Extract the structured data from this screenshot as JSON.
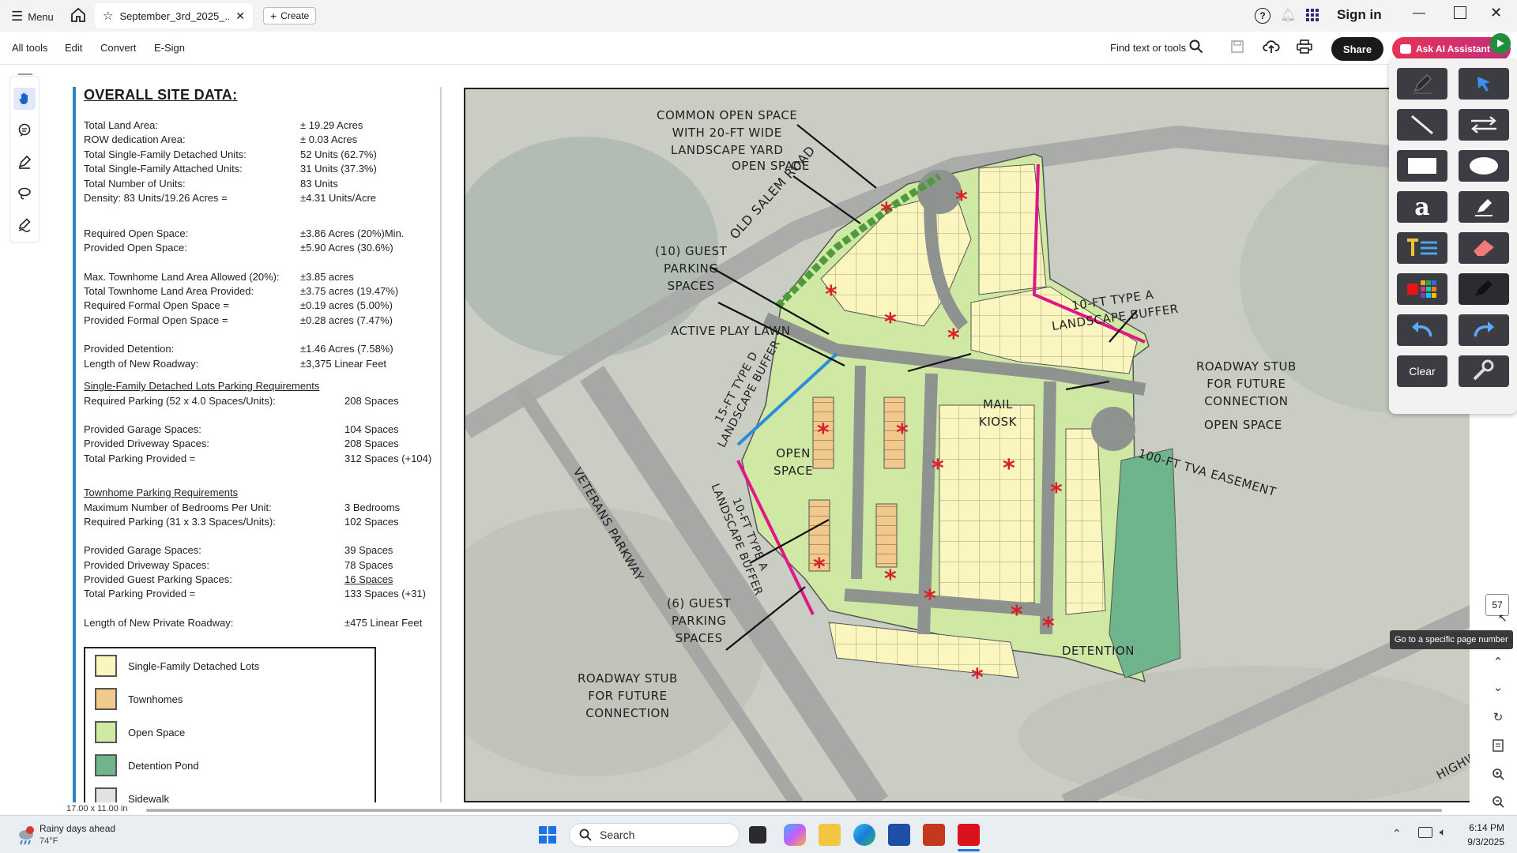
{
  "titlebar": {
    "menu_label": "Menu",
    "tab_title": "September_3rd_2025_...",
    "create_label": "Create",
    "sign_in": "Sign in"
  },
  "toolbar": {
    "items": [
      "All tools",
      "Edit",
      "Convert",
      "E-Sign"
    ],
    "find_label": "Find text or tools",
    "share_label": "Share",
    "ai_label": "Ask AI Assistant"
  },
  "site_data": {
    "title": "OVERALL SITE DATA:",
    "rows": [
      {
        "label": "Total Land Area:",
        "value": "± 19.29 Acres"
      },
      {
        "label": "ROW dedication Area:",
        "value": "± 0.03 Acres"
      },
      {
        "label": "Total Single-Family Detached Units:",
        "value": "52 Units (62.7%)"
      },
      {
        "label": "Total Single-Family Attached Units:",
        "value": "31 Units (37.3%)"
      },
      {
        "label": "Total Number of Units:",
        "value": "83 Units"
      },
      {
        "label": "Density: 83 Units/19.26 Acres =",
        "value": "±4.31 Units/Acre"
      },
      {
        "label": "Required Open Space:",
        "value": "±3.86 Acres (20%)Min."
      },
      {
        "label": "Provided Open Space:",
        "value": "±5.90 Acres (30.6%)"
      },
      {
        "label": "Max. Townhome Land Area Allowed (20%):",
        "value": "±3.85 acres"
      },
      {
        "label": "Total Townhome Land Area Provided:",
        "value": "±3.75 acres (19.47%)"
      },
      {
        "label": "Required Formal Open Space =",
        "value": "±0.19 acres (5.00%)"
      },
      {
        "label": "Provided Formal Open Space =",
        "value": "±0.28 acres (7.47%)"
      },
      {
        "label": "Provided Detention:",
        "value": "±1.46 Acres (7.58%)"
      },
      {
        "label": "Length of New Roadway:",
        "value": "±3,375 Linear Feet"
      }
    ],
    "sf_heading": "Single-Family Detached Lots Parking Requirements",
    "sf_rows": [
      {
        "label": "Required Parking (52 x 4.0 Spaces/Units):",
        "value": "208 Spaces"
      },
      {
        "label": "Provided Garage Spaces:",
        "value": "104 Spaces"
      },
      {
        "label": "Provided Driveway Spaces:",
        "value": "208 Spaces"
      },
      {
        "label": "Total Parking Provided =",
        "value": "312 Spaces (+104)"
      }
    ],
    "th_heading": "Townhome Parking Requirements",
    "th_rows": [
      {
        "label": "Maximum Number of Bedrooms Per Unit:",
        "value": "3 Bedrooms"
      },
      {
        "label": "Required Parking (31 x 3.3 Spaces/Units):",
        "value": "102 Spaces"
      },
      {
        "label": "Provided Garage Spaces:",
        "value": "39 Spaces"
      },
      {
        "label": "Provided Driveway Spaces:",
        "value": "78 Spaces"
      },
      {
        "label": "Provided Guest Parking Spaces:",
        "value": "16 Spaces"
      },
      {
        "label": "Total Parking Provided =",
        "value": "133 Spaces (+31)"
      },
      {
        "label": "Length of New Private Roadway:",
        "value": "±475 Linear Feet"
      }
    ]
  },
  "legend": [
    {
      "label": "Single-Family Detached Lots",
      "color": "#fbf5c0"
    },
    {
      "label": "Townhomes",
      "color": "#f1c98c"
    },
    {
      "label": "Open Space",
      "color": "#cfe8a3"
    },
    {
      "label": "Detention Pond",
      "color": "#6fb58c"
    },
    {
      "label": "Sidewalk",
      "color": "#e2e2e2"
    }
  ],
  "map_labels": {
    "common_open": "COMMON OPEN SPACE\nWITH 20-FT WIDE\nLANDSCAPE YARD",
    "open_space_top": "OPEN SPACE",
    "old_salem": "OLD SALEM ROAD",
    "guest10": "(10) GUEST\nPARKING\nSPACES",
    "active_play": "ACTIVE PLAY LAWN",
    "type_d": "15-FT TYPE D\nLANDSCAPE BUFFER",
    "open_space_mid": "OPEN\nSPACE",
    "type_a_left": "10-FT TYPE A\nLANDSCAPE BUFFER",
    "veterans": "VETERANS PARKWAY",
    "mail": "MAIL\nKIOSK",
    "type_a_right": "10-FT TYPE A\nLANDSCAPE BUFFER",
    "stub_right": "ROADWAY STUB\nFOR FUTURE\nCONNECTION",
    "open_space_right": "OPEN SPACE",
    "tva": "100-FT TVA EASEMENT",
    "guest6": "(6) GUEST\nPARKING\nSPACES",
    "stub_bottom": "ROADWAY STUB\nFOR FUTURE\nCONNECTION",
    "detention": "DETENTION",
    "highway": "HIGHWAY"
  },
  "nav": {
    "page_number": "57",
    "tooltip": "Go to a specific page number",
    "doc_size": "17.00 x 11.00 in"
  },
  "taskbar": {
    "weather_title": "Rainy days ahead",
    "weather_temp": "74°F",
    "search_label": "Search",
    "time": "6:14 PM",
    "date": "9/3/2025"
  }
}
